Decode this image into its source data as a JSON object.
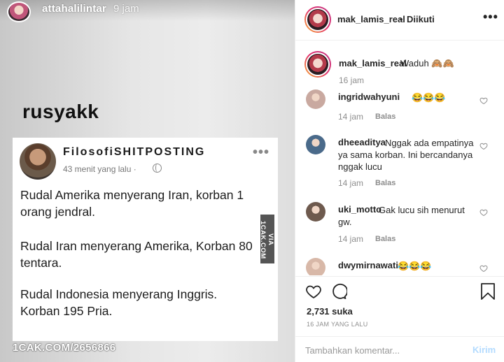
{
  "story": {
    "username": "attahalilintar",
    "time": "9 jam",
    "caption": "rusyakk",
    "meme": {
      "page_name": "FilosofiSHITPOSTING",
      "posted": "43 menit yang lalu ·",
      "more": "•••",
      "paragraphs": [
        "Rudal Amerika menyerang Iran, korban 1 orang jendral.",
        "Rudal Iran menyerang Amerika, Korban 80 tentara.",
        "Rudal Indonesia menyerang Inggris. Korban 195 Pria."
      ],
      "side_watermark": "VIA 1CAK.COM",
      "bottom_watermark": "1CAK.COM/2656866"
    }
  },
  "post": {
    "header": {
      "username": "mak_lamis_real",
      "separator": "•",
      "follow_status": "Diikuti",
      "more": "•••"
    },
    "caption": {
      "username": "mak_lamis_real",
      "text": "Waduh 🙈🙈",
      "time": "16 jam"
    },
    "comments": [
      {
        "username": "ingridwahyuni",
        "text": "😂😂😂",
        "time": "14 jam",
        "reply": "Balas",
        "avatar_color": "#c9a9a0"
      },
      {
        "username": "dheeaditya",
        "text": "Nggak ada empatinya ya sama korban. Ini bercandanya nggak lucu",
        "time": "14 jam",
        "reply": "Balas",
        "avatar_color": "#4a6a8a"
      },
      {
        "username": "uki_motto",
        "text": "Gak lucu sih menurut gw.",
        "time": "14 jam",
        "reply": "Balas",
        "avatar_color": "#6e5a4e"
      },
      {
        "username": "dwymirnawati",
        "text": "😂😂😂",
        "avatar_color": "#d8b8a8"
      }
    ],
    "likes": "2,731 suka",
    "post_time": "16 JAM YANG LALU",
    "compose": {
      "placeholder": "Tambahkan komentar...",
      "send_label": "Kirim"
    }
  }
}
